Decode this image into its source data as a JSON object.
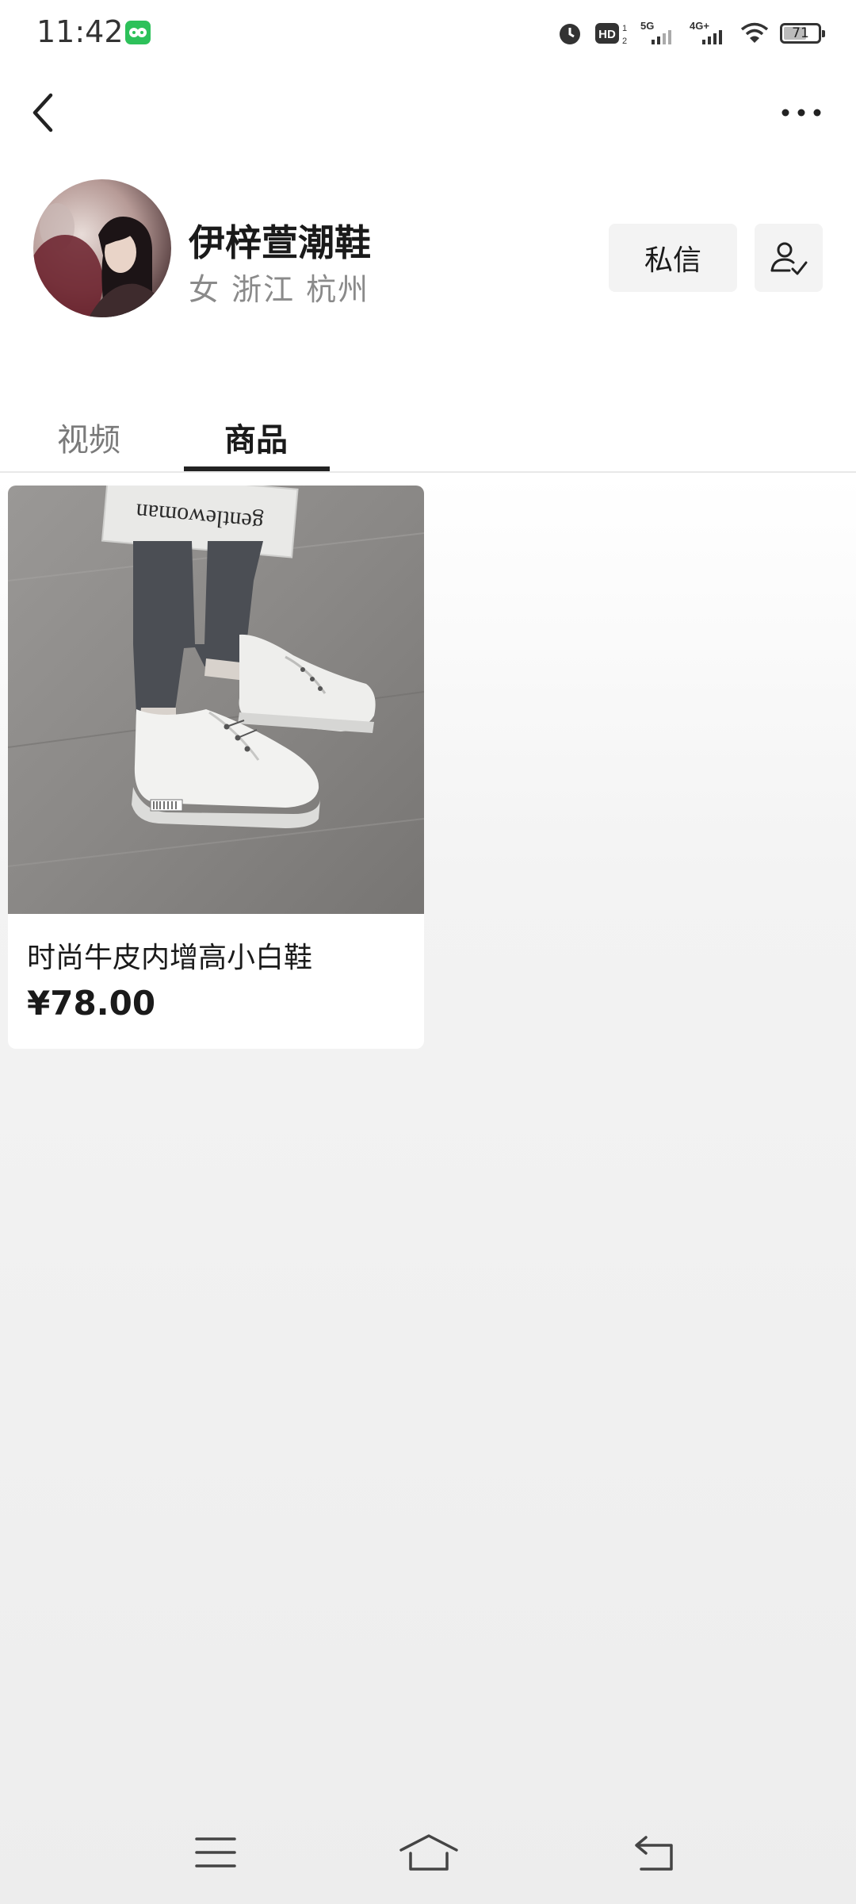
{
  "status_bar": {
    "time": "11:42",
    "battery": "71",
    "battery_level": 0.71,
    "icons": [
      "wechat-icon",
      "alarm-icon",
      "hd-icon",
      "signal-5g-icon",
      "signal-4g-icon",
      "wifi-icon",
      "battery-icon"
    ]
  },
  "nav": {
    "back_icon": "chevron-left-icon",
    "more_icon": "more-horizontal-icon"
  },
  "profile": {
    "name": "伊梓萱潮鞋",
    "meta": "女 浙江 杭州",
    "message_button": "私信",
    "follow_icon": "user-check-icon"
  },
  "tabs": [
    {
      "label": "视频",
      "active": false
    },
    {
      "label": "商品",
      "active": true
    }
  ],
  "products": [
    {
      "title": "时尚牛皮内增高小白鞋",
      "price": "¥78.00",
      "image_text": "gentlewoman"
    }
  ],
  "system_nav": {
    "icons": [
      "menu-icon",
      "home-icon",
      "back-icon"
    ]
  },
  "colors": {
    "accent_wechat": "#2dc15a",
    "text_primary": "#1a1a1a",
    "text_secondary": "#8a8a8a",
    "button_bg": "#f3f3f3"
  }
}
